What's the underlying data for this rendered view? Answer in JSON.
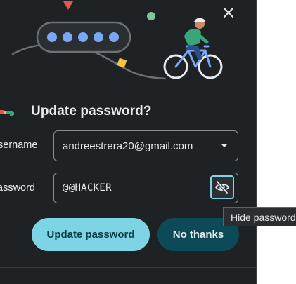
{
  "dialog": {
    "title": "Update password?",
    "close_icon": "close-icon",
    "key_icon": "key-icon",
    "username": {
      "label": "sername",
      "value": "andreestrera20@gmail.com",
      "icon": "chevron-down-icon"
    },
    "password": {
      "label": "assword",
      "value": "@@HACKER",
      "toggle_icon": "eye-off-icon",
      "tooltip": "Hide password"
    },
    "buttons": {
      "update": "Update password",
      "no_thanks": "No thanks"
    }
  },
  "colors": {
    "dialog_bg": "#1f2224",
    "primary_button": "#7dd4e4",
    "secondary_button": "#0d4a57",
    "focus_ring": "#7fd3e5",
    "text": "#e8eaed"
  }
}
